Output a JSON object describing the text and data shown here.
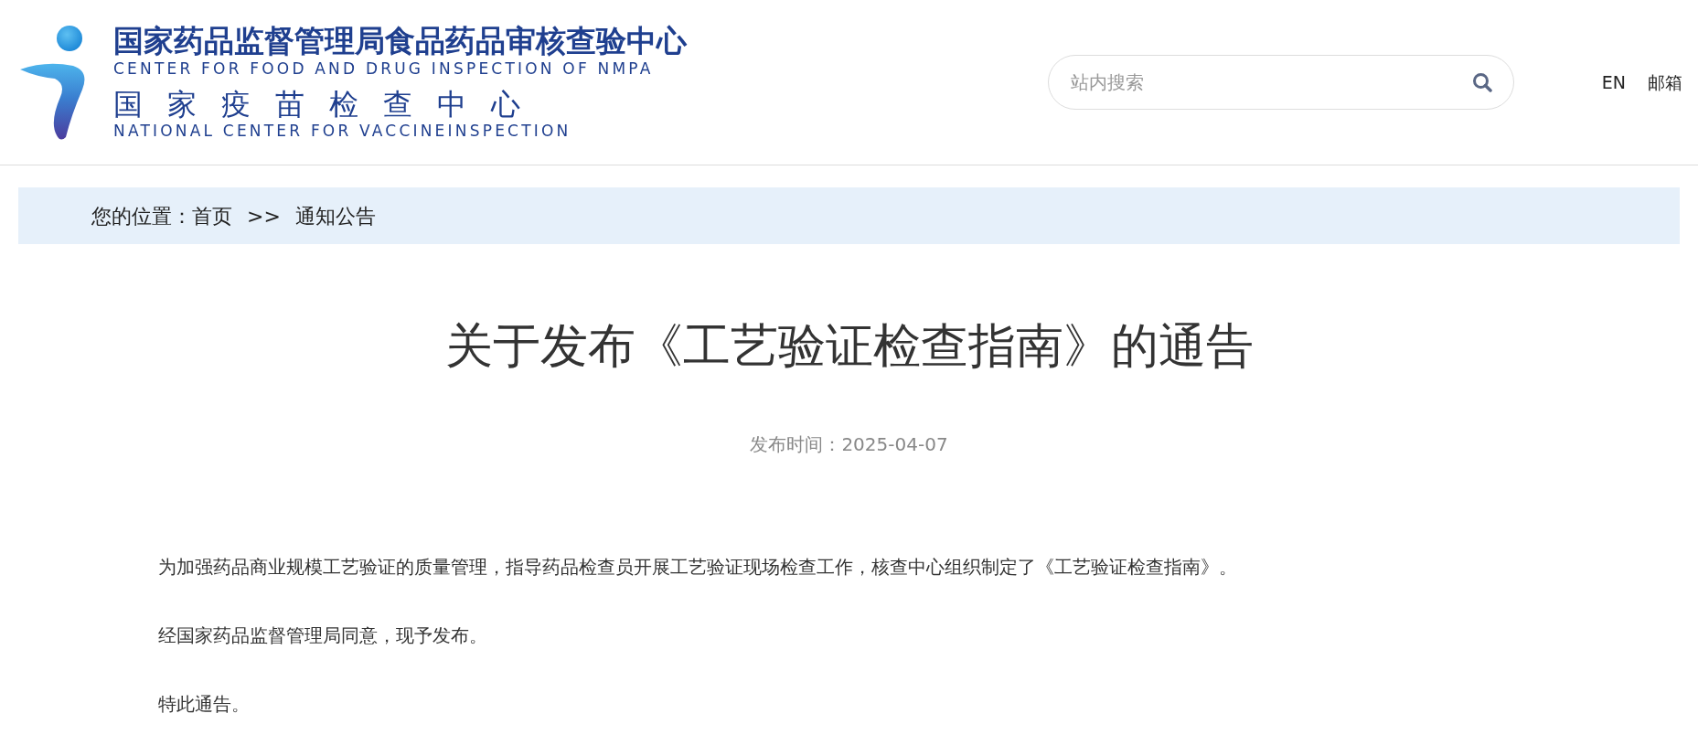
{
  "logo": {
    "name_cn": "国家药品监督管理局食品药品审核查验中心",
    "name_en": "CENTER FOR FOOD AND DRUG INSPECTION OF NMPA",
    "name2_cn": "国家疫苗检查中心",
    "name2_en": "NATIONAL CENTER FOR VACCINEINSPECTION"
  },
  "search": {
    "placeholder": "站内搜索"
  },
  "header_links": [
    "EN",
    "邮箱"
  ],
  "breadcrumb": {
    "label": "您的位置：",
    "items": [
      "首页",
      "通知公告"
    ],
    "separator": ">>"
  },
  "article": {
    "title": "关于发布《工艺验证检查指南》的通告",
    "date": "发布时间：2025-04-07",
    "paragraphs": [
      "为加强药品商业规模工艺验证的质量管理，指导药品检查员开展工艺验证现场检查工作，核查中心组织制定了《工艺验证检查指南》。",
      "经国家药品监督管理局同意，现予发布。",
      "特此通告。"
    ]
  }
}
